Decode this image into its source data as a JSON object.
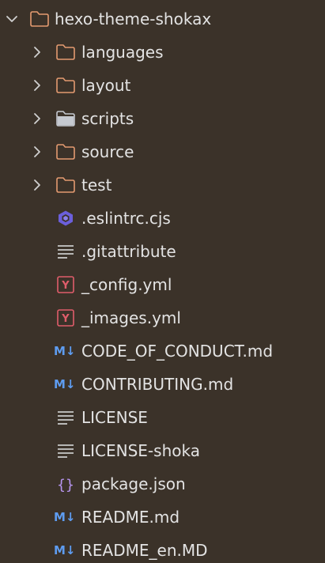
{
  "colors": {
    "background": "#3b3229",
    "text": "#e3e3e3",
    "folder_orange": "#e39a70",
    "folder_gray": "#c5c9d0",
    "chevron": "#d0d0d0",
    "yaml_red": "#e05d6b",
    "markdown_blue": "#5e9cf0",
    "json_purple": "#b795f0",
    "eslint_purple": "#6b5fdb"
  },
  "tree": {
    "root": {
      "label": "hexo-theme-shokax",
      "icon": "folder-icon",
      "expanded": true
    },
    "items": [
      {
        "label": "languages",
        "icon": "folder-icon",
        "type": "folder",
        "expanded": false
      },
      {
        "label": "layout",
        "icon": "folder-icon",
        "type": "folder",
        "expanded": false
      },
      {
        "label": "scripts",
        "icon": "folder-icon",
        "type": "folder",
        "expanded": false
      },
      {
        "label": "source",
        "icon": "folder-icon",
        "type": "folder",
        "expanded": false
      },
      {
        "label": "test",
        "icon": "folder-icon",
        "type": "folder",
        "expanded": false
      },
      {
        "label": ".eslintrc.cjs",
        "icon": "eslint-icon",
        "type": "file"
      },
      {
        "label": ".gitattribute",
        "icon": "text-file-icon",
        "type": "file"
      },
      {
        "label": "_config.yml",
        "icon": "yaml-icon",
        "type": "file",
        "icon_text": "Y"
      },
      {
        "label": "_images.yml",
        "icon": "yaml-icon",
        "type": "file",
        "icon_text": "Y"
      },
      {
        "label": "CODE_OF_CONDUCT.md",
        "icon": "markdown-icon",
        "type": "file",
        "icon_text": "M↓"
      },
      {
        "label": "CONTRIBUTING.md",
        "icon": "markdown-icon",
        "type": "file",
        "icon_text": "M↓"
      },
      {
        "label": "LICENSE",
        "icon": "text-file-icon",
        "type": "file"
      },
      {
        "label": "LICENSE-shoka",
        "icon": "text-file-icon",
        "type": "file"
      },
      {
        "label": "package.json",
        "icon": "json-icon",
        "type": "file",
        "icon_text": "{}"
      },
      {
        "label": "README.md",
        "icon": "markdown-icon",
        "type": "file",
        "icon_text": "M↓"
      },
      {
        "label": "README_en.MD",
        "icon": "markdown-icon",
        "type": "file",
        "icon_text": "M↓"
      }
    ]
  }
}
